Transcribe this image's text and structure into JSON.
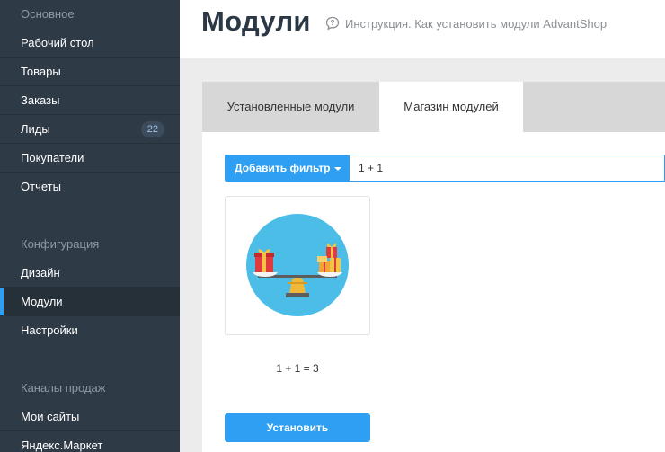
{
  "sidebar": {
    "section_main": "Основное",
    "main_items": [
      "Рабочий стол",
      "Товары",
      "Заказы",
      "Лиды",
      "Покупатели",
      "Отчеты"
    ],
    "leads_badge": "22",
    "section_config": "Конфигурация",
    "config_items": [
      "Дизайн",
      "Модули",
      "Настройки"
    ],
    "section_channels": "Каналы продаж",
    "channel_items": [
      "Мои сайты",
      "Яндекс.Маркет"
    ]
  },
  "header": {
    "title": "Модули",
    "help_text": "Инструкция. Как установить модули AdvantShop"
  },
  "tabs": [
    "Установленные модули",
    "Магазин модулей"
  ],
  "filter": {
    "button_label": "Добавить фильтр",
    "value": "1 + 1"
  },
  "module": {
    "name": "1 + 1 = 3",
    "install_label": "Установить"
  },
  "colors": {
    "sidebar_bg": "#2f3a47",
    "accent": "#2e9ff2",
    "active_indicator": "#2e9ff2",
    "card_circle": "#4bbde6"
  }
}
